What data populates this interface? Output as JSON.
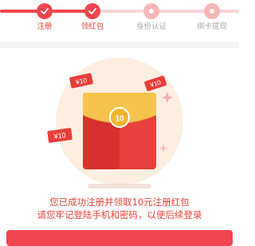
{
  "steps": [
    {
      "label": "注册",
      "status": "done"
    },
    {
      "label": "领红包",
      "status": "done"
    },
    {
      "label": "身份认证",
      "status": "pending"
    },
    {
      "label": "绑卡提现",
      "status": "pending"
    }
  ],
  "envelope": {
    "coin_value": "10",
    "coupon_text": "¥10"
  },
  "message": {
    "line1": "您已成功注册并领取10元注册红包",
    "line2": "请您牢记登陆手机和密码，以便后续登录"
  },
  "colors": {
    "accent": "#f0474e",
    "accent_light": "#f7b6ba",
    "text_accent": "#e8453c",
    "inactive_label": "#aaaaaa",
    "inactive_track": "#f8d6d8",
    "envelope_red": "#e8403e",
    "envelope_red_dark": "#d7302f",
    "envelope_flap": "#f6c44c",
    "coin": "#f2b531",
    "halo": "#fdeee2"
  },
  "icons": {
    "done": "check-icon",
    "pending": "circle-dot-icon",
    "envelope": "red-envelope-icon",
    "coupon": "coupon-tag-icon",
    "sparkle": "sparkle-icon"
  }
}
